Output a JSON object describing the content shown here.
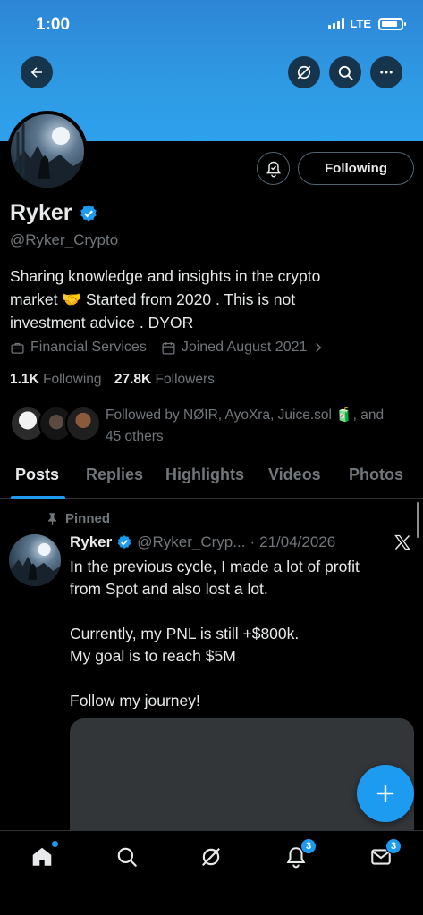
{
  "status_bar": {
    "time": "1:00",
    "network": "LTE"
  },
  "header": {
    "back": "back-arrow",
    "actions": [
      "grok-icon",
      "search-icon",
      "more-icon"
    ]
  },
  "profile": {
    "name": "Ryker",
    "handle": "@Ryker_Crypto",
    "verified": true,
    "follow_state": "Following",
    "bio_line1": "Sharing knowledge and insights in the crypto",
    "bio_line2_a": "market",
    "bio_line2_emoji": "🤝",
    "bio_line2_b": "Started from 2020 . This is not",
    "bio_line3": "investment advice . DYOR",
    "category": "Financial Services",
    "joined": "Joined August 2021",
    "following_count": "1.1K",
    "following_label": "Following",
    "followers_count": "27.8K",
    "followers_label": "Followers",
    "followed_by_a": "Followed by NØIR, AyoXra, Juice.sol",
    "followed_by_emoji": "🧃",
    "followed_by_b": ", and",
    "followed_by_c": "45 others"
  },
  "tabs": [
    "Posts",
    "Replies",
    "Highlights",
    "Videos",
    "Photos"
  ],
  "active_tab": "Posts",
  "pinned_post": {
    "pinned_label": "Pinned",
    "author": "Ryker",
    "handle": "@Ryker_Cryp...",
    "separator": "·",
    "date": "21/04/2026",
    "text": "In the previous cycle, I made a lot of profit\nfrom Spot and also lost a lot.\n\nCurrently, my PNL is still +$800k.\nMy goal is to reach $5M\n\nFollow my journey!"
  },
  "bottom_nav": {
    "items": [
      "home-icon",
      "search-icon",
      "grok-icon",
      "notifications-icon",
      "messages-icon"
    ],
    "notifications_badge": "3",
    "messages_badge": "3"
  },
  "colors": {
    "accent": "#1d9bf0",
    "banner": "#2f9ae4",
    "muted": "#71767b",
    "background": "#000000"
  }
}
